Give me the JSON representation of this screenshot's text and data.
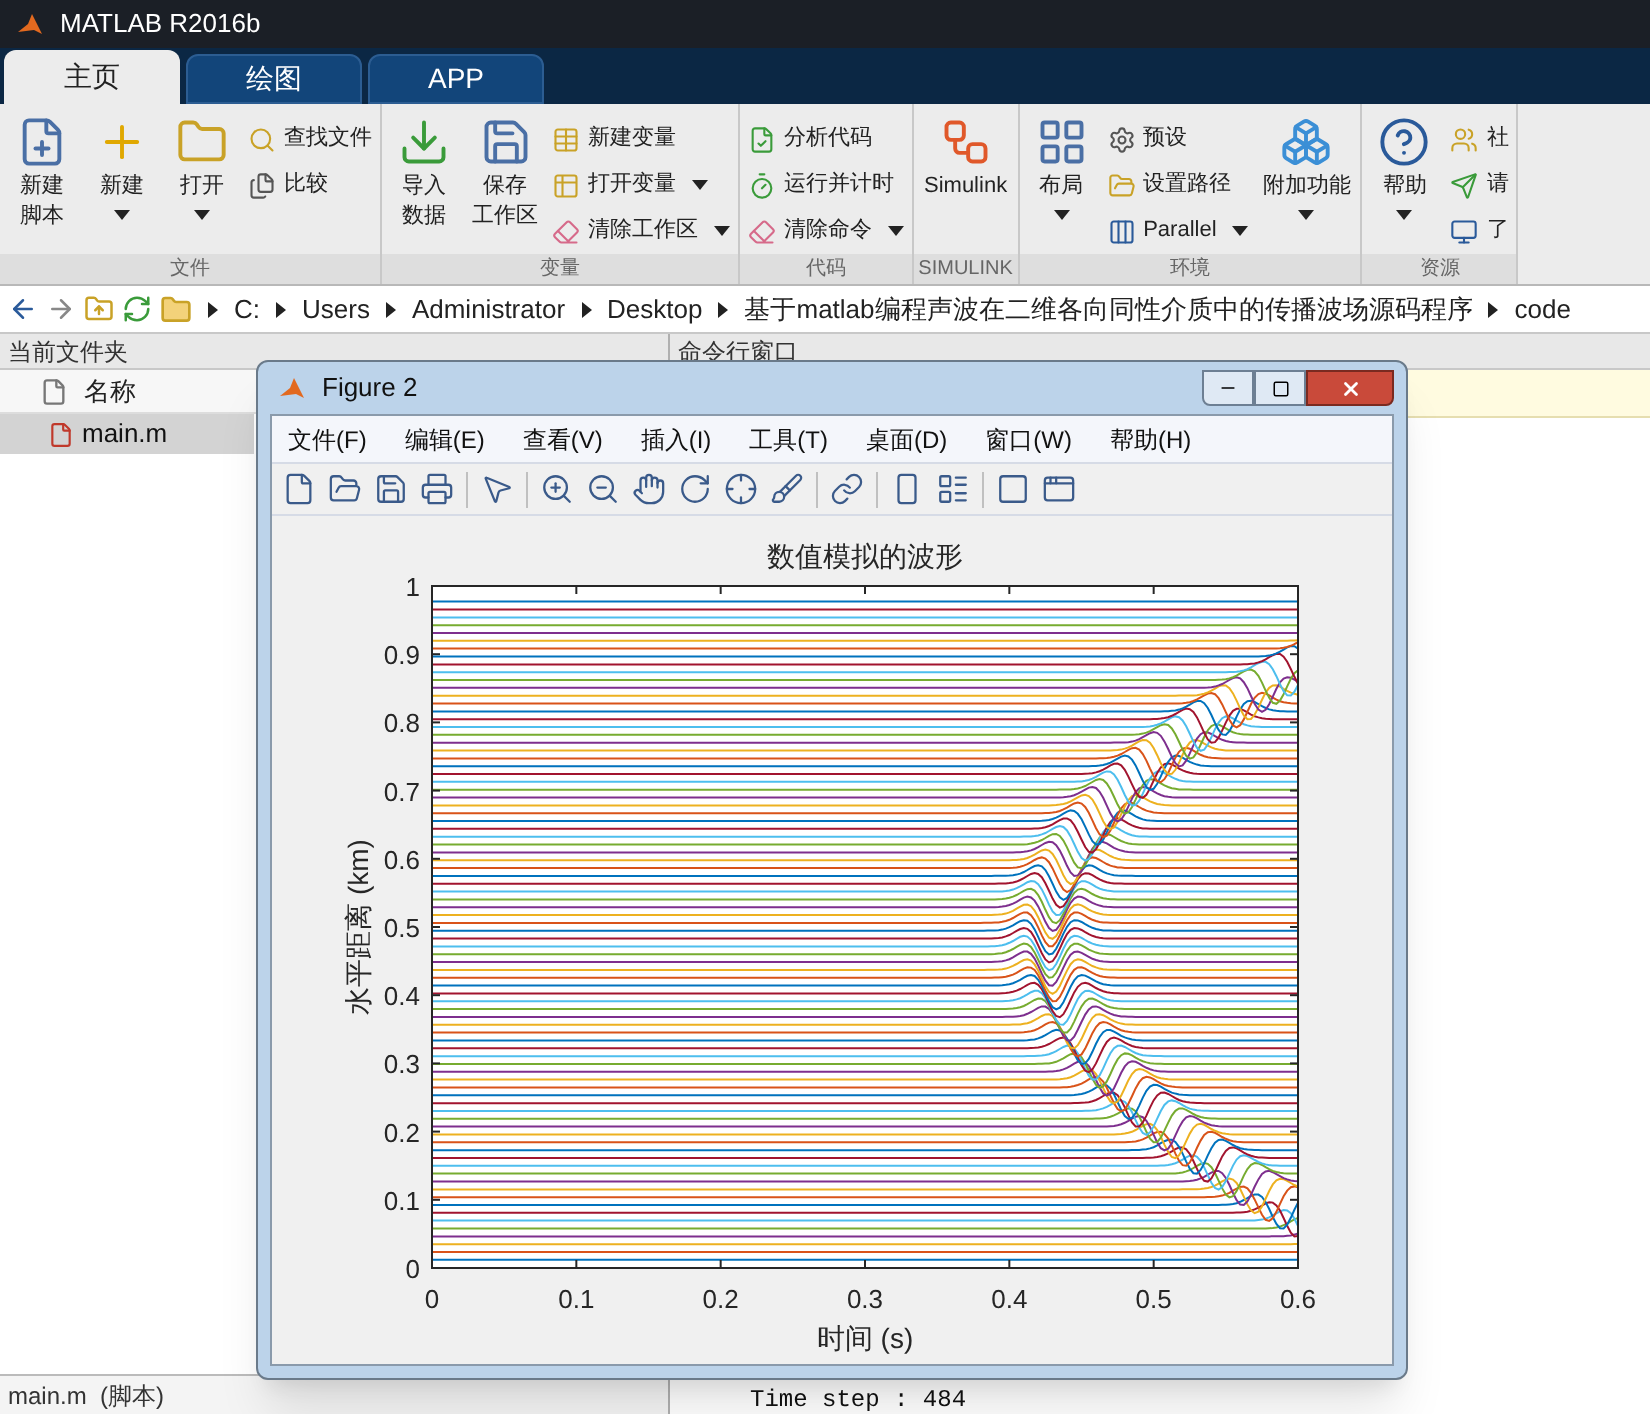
{
  "window": {
    "title": "MATLAB R2016b"
  },
  "tabs": [
    {
      "label": "主页",
      "selected": true
    },
    {
      "label": "绘图",
      "selected": false
    },
    {
      "label": "APP",
      "selected": false
    }
  ],
  "ribbon": [
    {
      "label": "文件",
      "items": [
        {
          "kind": "large",
          "lines": [
            "新建",
            "脚本"
          ],
          "dropdown": false
        },
        {
          "kind": "large",
          "lines": [
            "新建"
          ],
          "dropdown": true
        },
        {
          "kind": "large",
          "lines": [
            "打开"
          ],
          "dropdown": true
        },
        {
          "kind": "stack",
          "entries": [
            {
              "label": "查找文件",
              "dropdown": false
            },
            {
              "label": "比较",
              "dropdown": false
            }
          ]
        }
      ]
    },
    {
      "label": "变量",
      "items": [
        {
          "kind": "large",
          "lines": [
            "导入",
            "数据"
          ],
          "dropdown": false
        },
        {
          "kind": "large",
          "lines": [
            "保存",
            "工作区"
          ],
          "dropdown": false
        },
        {
          "kind": "stack",
          "entries": [
            {
              "label": "新建变量",
              "dropdown": false
            },
            {
              "label": "打开变量",
              "dropdown": true
            },
            {
              "label": "清除工作区",
              "dropdown": true
            }
          ]
        }
      ]
    },
    {
      "label": "代码",
      "items": [
        {
          "kind": "stack",
          "entries": [
            {
              "label": "分析代码",
              "dropdown": false
            },
            {
              "label": "运行并计时",
              "dropdown": false
            },
            {
              "label": "清除命令",
              "dropdown": true
            }
          ]
        }
      ]
    },
    {
      "label": "SIMULINK",
      "items": [
        {
          "kind": "large",
          "lines": [
            "Simulink"
          ],
          "dropdown": false
        }
      ]
    },
    {
      "label": "环境",
      "items": [
        {
          "kind": "large",
          "lines": [
            "布局"
          ],
          "dropdown": true
        },
        {
          "kind": "stack",
          "entries": [
            {
              "label": "预设",
              "dropdown": false
            },
            {
              "label": "设置路径",
              "dropdown": false
            },
            {
              "label": "Parallel",
              "dropdown": true
            }
          ]
        },
        {
          "kind": "large",
          "lines": [
            "附加功能"
          ],
          "dropdown": true
        }
      ]
    },
    {
      "label": "资源",
      "items": [
        {
          "kind": "large",
          "lines": [
            "帮助"
          ],
          "dropdown": true
        },
        {
          "kind": "stack",
          "entries": [
            {
              "label": "社",
              "dropdown": false
            },
            {
              "label": "请",
              "dropdown": false
            },
            {
              "label": "了",
              "dropdown": false
            }
          ]
        }
      ]
    }
  ],
  "address": {
    "crumbs": [
      "C:",
      "Users",
      "Administrator",
      "Desktop",
      "基于matlab编程声波在二维各向同性介质中的传播波场源码程序",
      "code"
    ]
  },
  "files_panel": {
    "title": "当前文件夹",
    "column": "名称",
    "rows": [
      {
        "name": "main.m",
        "selected": true
      }
    ],
    "details": "main.m  (脚本)"
  },
  "command_window": {
    "title": "命令行窗口",
    "lines": [
      "Time step : 484"
    ]
  },
  "figure": {
    "title": "Figure 2",
    "menu": [
      "文件(F)",
      "编辑(E)",
      "查看(V)",
      "插入(I)",
      "工具(T)",
      "桌面(D)",
      "窗口(W)",
      "帮助(H)"
    ],
    "plot": {
      "title": "数值模拟的波形",
      "xlabel": "时间 (s)",
      "ylabel": "水平距离 (km)",
      "xticks": [
        "0",
        "0.1",
        "0.2",
        "0.3",
        "0.4",
        "0.5",
        "0.6"
      ],
      "yticks": [
        "1",
        "0.9",
        "0.8",
        "0.7",
        "0.6",
        "0.5",
        "0.4",
        "0.3",
        "0.2",
        "0.1",
        "0"
      ]
    }
  }
}
